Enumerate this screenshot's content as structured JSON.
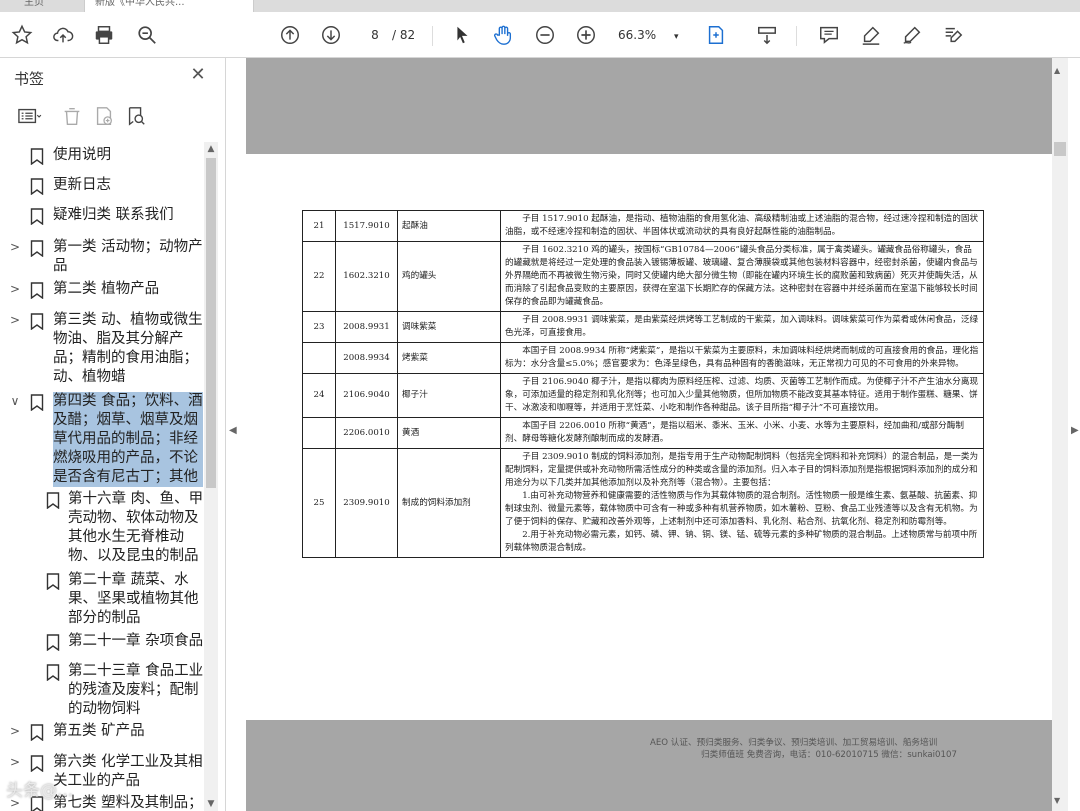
{
  "tabs": [
    {
      "label": "主页"
    },
    {
      "label": "新版《中华人民共..."
    }
  ],
  "toolbar": {
    "page_current": "8",
    "page_total": "/ 82",
    "zoom": "66.3%",
    "zoom_arrow": "▾"
  },
  "sidebar": {
    "title": "书签",
    "close": "✕",
    "items": [
      {
        "label": "使用说明"
      },
      {
        "label": "更新日志"
      },
      {
        "label": "疑难归类  联系我们"
      },
      {
        "label": "第一类  活动物；动物产品",
        "caret": ">"
      },
      {
        "label": "第二类 植物产品",
        "caret": ">"
      },
      {
        "label": "第三类 动、植物或微生物油、脂及其分解产品；精制的食用油脂；动、植物蜡",
        "caret": ">"
      },
      {
        "label": "第四类 食品；饮料、酒及醋；烟草、烟草及烟草代用品的制品；非经燃烧吸用的产品，不论是否含有尼古丁；其他",
        "caret": "∨"
      },
      {
        "label": "第十六章 肉、鱼、甲壳动物、软体动物及其他水生无脊椎动物、以及昆虫的制品"
      },
      {
        "label": "第二十章 蔬菜、水果、坚果或植物其他部分的制品"
      },
      {
        "label": "第二十一章 杂项食品"
      },
      {
        "label": "第二十三章 食品工业的残渣及废料；配制的动物饲料"
      },
      {
        "label": "第五类 矿产品",
        "caret": ">"
      },
      {
        "label": "第六类 化学工业及其相关工业的产品",
        "caret": ">"
      },
      {
        "label": "第七类 塑料及其制品；",
        "caret": ">"
      }
    ]
  },
  "document": {
    "rows": [
      {
        "no": "21",
        "code": "1517.9010",
        "name": "起酥油",
        "desc": "子目 1517.9010 起酥油，是指动、植物油脂的食用氢化油、高级精制油或上述油脂的混合物，经过速冷捏和制造的固状油脂，或不经速冷捏和制造的固状、半固体状或流动状的具有良好起酥性能的油脂制品。"
      },
      {
        "no": "22",
        "code": "1602.3210",
        "name": "鸡的罐头",
        "desc": "子目 1602.3210 鸡的罐头，按国标“GB10784—2006”罐头食品分类标准，属于禽类罐头。罐藏食品俗称罐头，食品的罐藏就是将经过一定处理的食品装入镀锡薄板罐、玻璃罐、复合薄膜袋或其他包装材料容器中，经密封杀菌，使罐内食品与外界隔绝而不再被微生物污染，同时又使罐内绝大部分微生物（即能在罐内环境生长的腐败菌和致病菌）死灭并使酶失活，从而消除了引起食品变败的主要原因，获得在室温下长期贮存的保藏方法。这种密封在容器中并经杀菌而在室温下能够较长时间保存的食品即为罐藏食品。"
      },
      {
        "no": "23",
        "code": "2008.9931",
        "name": "调味紫菜",
        "desc": "子目 2008.9931 调味紫菜，是由紫菜经烘烤等工艺制成的干紫菜，加入调味料。调味紫菜可作为菜肴或休闲食品，泛绿色光泽，可直接食用。"
      },
      {
        "no": "",
        "code": "2008.9934",
        "name": "烤紫菜",
        "desc": "本国子目 2008.9934 所称“烤紫菜”，是指以干紫菜为主要原料，未加调味料经烘烤而制成的可直接食用的食品，理化指标为：水分含量≤5.0%；感官要求为：色泽呈绿色，具有品种固有的香脆滋味，无正常视力可见的不可食用的外来异物。"
      },
      {
        "no": "24",
        "code": "2106.9040",
        "name": "椰子汁",
        "desc": "子目 2106.9040 椰子汁，是指以椰肉为原料经压榨、过滤、均质、灭菌等工艺制作而成。为使椰子汁不产生油水分离现象，可添加适量的稳定剂和乳化剂等；也可加入少量其他物质，但所加物质不能改变其基本特征。适用于制作蛋糕、糖果、饼干、冰激凌和咖喱等，并适用于烹饪菜、小吃和制作各种甜品。该子目所指“椰子汁”不可直接饮用。"
      },
      {
        "no": "",
        "code": "2206.0010",
        "name": "黄酒",
        "desc": "本国子目 2206.0010 所称“黄酒”，是指以稻米、黍米、玉米、小米、小麦、水等为主要原料，经加曲和/或部分酶制剂、酵母等糖化发酵剂酿制而成的发酵酒。"
      },
      {
        "no": "25",
        "code": "2309.9010",
        "name": "制成的饲料添加剂",
        "desc": "子目 2309.9010 制成的饲料添加剂，是指专用于生产动物配制饲料（包括完全饲料和补充饲料）的混合制品，是一类为配制饲料，定量提供或补充动物所需活性成分的种类或含量的添加剂。归入本子目的饲料添加剂是指根据饲料添加剂的成分和用途分为以下几类并加其他添加剂以及补充剂等（混合物）。主要包括：",
        "extra": [
          "1.由可补充动物营养和健康需要的活性物质与作为其载体物质的混合制剂。活性物质一般是维生素、氨基酸、抗菌素、抑制球虫剂、微量元素等，载体物质中可含有一种或多种有机营养物质，如木薯粉、豆粉、食品工业残渣等以及含有无机物。为了便于饲料的保存、贮藏和改善外观等，上述制剂中还可添加香料、乳化剂、粘合剂、抗氧化剂、稳定剂和防霉剂等。",
          "2.用于补充动物必需元素，如钙、磷、钾、钠、铜、镁、锰、硫等元素的多种矿物质的混合制品。上述物质常与前项中所列载体物质混合制成。"
        ]
      }
    ],
    "footer_line1": "AEO 认证、预归类服务、归类争议、预归类培训、加工贸易培训、船务培训",
    "footer_line2": "归类师值班 免费咨询，电话：010-62010715 微信：sunkai0107"
  },
  "watermark": "头条@...",
  "colors": {
    "selected_bookmark": "#a8c4e0",
    "viewer_bg": "#a6a6a6"
  }
}
